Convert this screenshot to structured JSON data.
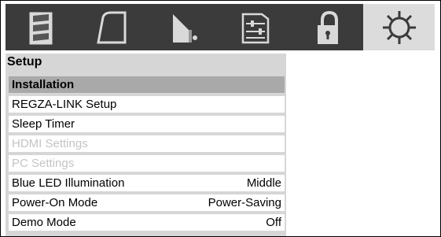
{
  "icon_tabs": [
    {
      "icon": "picture-icon",
      "active": false
    },
    {
      "icon": "screen-icon",
      "active": false
    },
    {
      "icon": "sound-icon",
      "active": false
    },
    {
      "icon": "preferences-icon",
      "active": false
    },
    {
      "icon": "lock-icon",
      "active": false
    },
    {
      "icon": "gear-icon",
      "active": true
    }
  ],
  "menu": {
    "title": "Setup",
    "items": [
      {
        "label": "Installation",
        "value": "",
        "state": "header"
      },
      {
        "label": "REGZA-LINK Setup",
        "value": "",
        "state": "normal"
      },
      {
        "label": "Sleep Timer",
        "value": "",
        "state": "normal"
      },
      {
        "label": "HDMI Settings",
        "value": "",
        "state": "disabled"
      },
      {
        "label": "PC Settings",
        "value": "",
        "state": "disabled"
      },
      {
        "label": "Blue LED Illumination",
        "value": "Middle",
        "state": "normal"
      },
      {
        "label": "Power-On Mode",
        "value": "Power-Saving",
        "state": "normal"
      },
      {
        "label": "Demo Mode",
        "value": "Off",
        "state": "normal"
      }
    ]
  },
  "colors": {
    "icon_bar": "#3b3b3b",
    "active_tab": "#dcdcdc",
    "panel": "#d6d6d6",
    "header_row": "#a9a9a9",
    "disabled_text": "#c4c4c4"
  }
}
